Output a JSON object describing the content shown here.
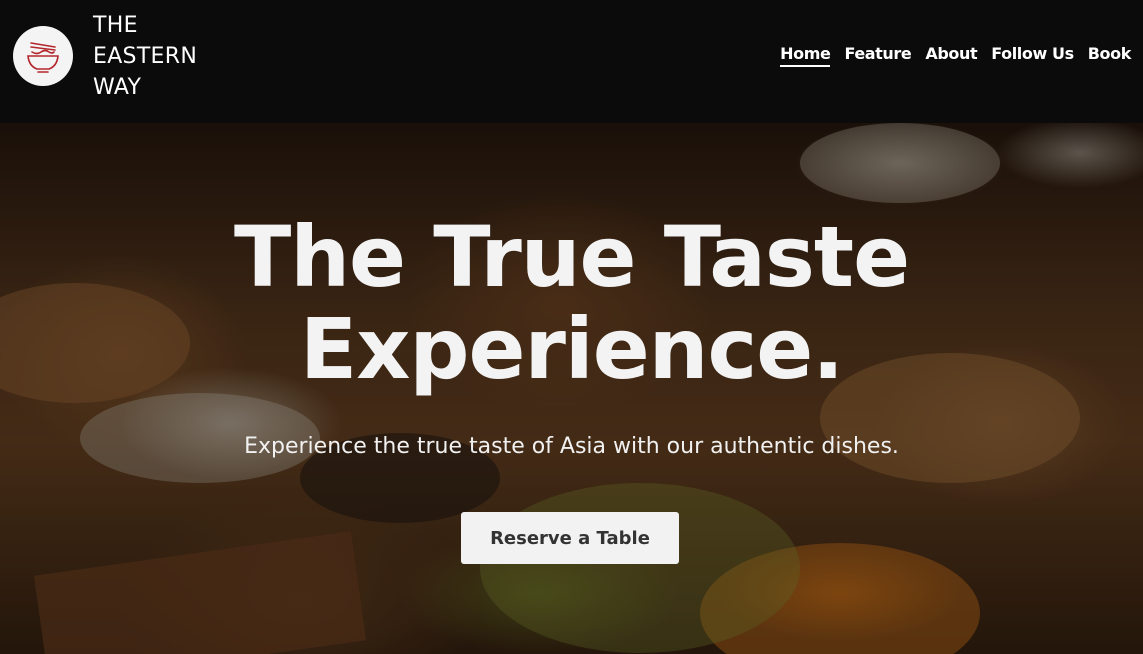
{
  "brand": {
    "logo_icon": "noodle-bowl-icon",
    "name_lines": [
      "THE",
      "EASTERN",
      "WAY"
    ]
  },
  "nav": {
    "items": [
      {
        "label": "Home",
        "active": true
      },
      {
        "label": "Feature",
        "active": false
      },
      {
        "label": "About",
        "active": false
      },
      {
        "label": "Follow Us",
        "active": false
      },
      {
        "label": "Book",
        "active": false
      }
    ]
  },
  "hero": {
    "title_lines": [
      "The True Taste",
      "Experience."
    ],
    "subtitle": "Experience the true taste of Asia with our authentic dishes.",
    "cta_label": "Reserve a Table",
    "background": "dim-sum-steamers-photo"
  },
  "colors": {
    "navbar_bg": "#0b0b0b",
    "logo_accent": "#b3262c",
    "button_bg": "#f2f2f2",
    "button_text": "#333333"
  }
}
